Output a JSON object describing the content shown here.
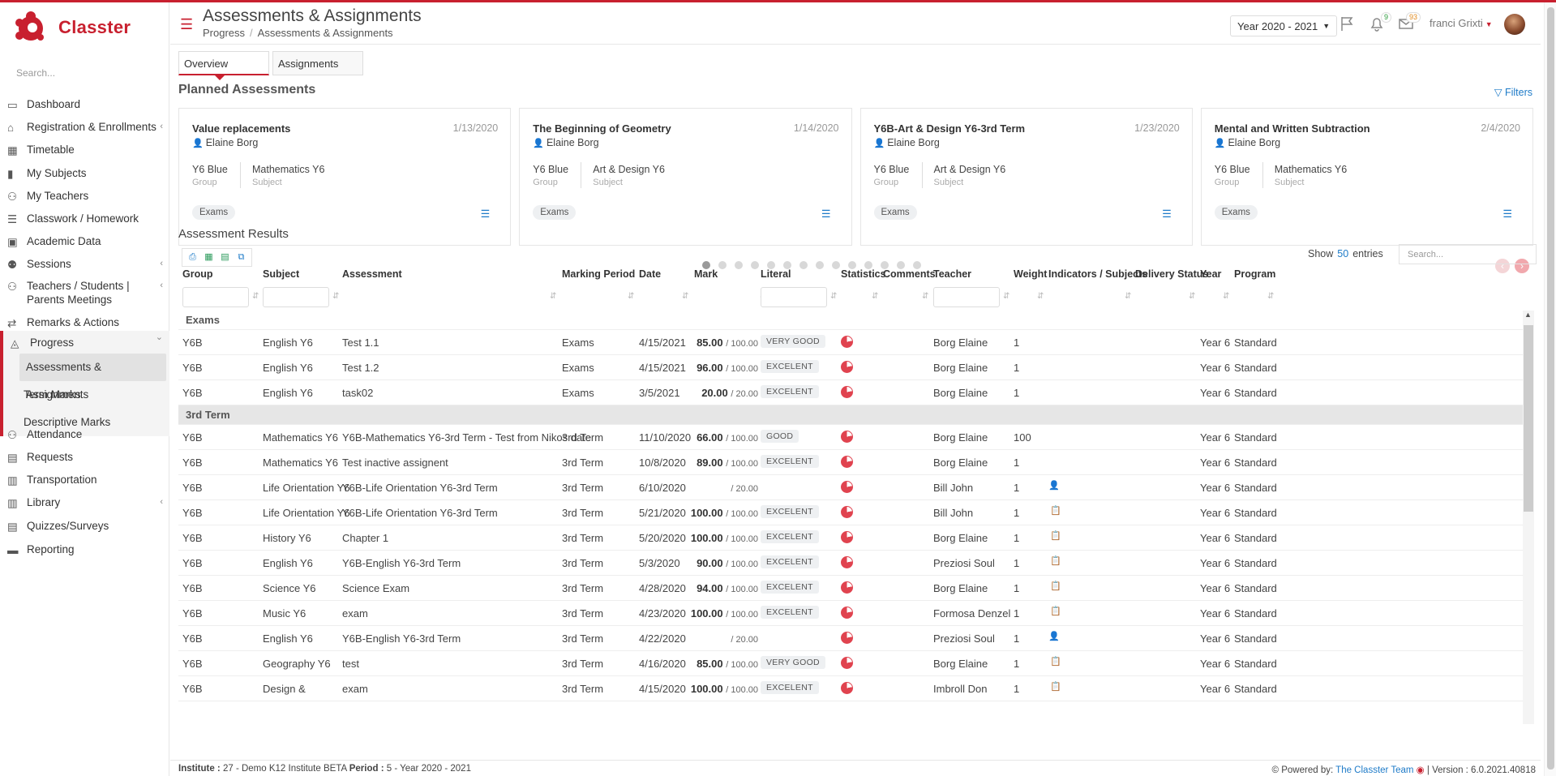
{
  "brand": {
    "name": "Classter",
    "color": "#c8202f"
  },
  "sidebar": {
    "search_placeholder": "Search...",
    "items": [
      {
        "label": "Dashboard",
        "icon": "laptop-icon"
      },
      {
        "label": "Registration & Enrollments",
        "icon": "bank-icon",
        "chev": "‹"
      },
      {
        "label": "Timetable",
        "icon": "calendar-icon"
      },
      {
        "label": "My Subjects",
        "icon": "book-icon"
      },
      {
        "label": "My Teachers",
        "icon": "users-icon"
      },
      {
        "label": "Classwork / Homework",
        "icon": "list-icon"
      },
      {
        "label": "Academic Data",
        "icon": "user-card-icon"
      },
      {
        "label": "Sessions",
        "icon": "group-icon",
        "chev": "‹"
      },
      {
        "label": "Teachers / Students | Parents Meetings",
        "icon": "meeting-icon",
        "chev": "‹"
      },
      {
        "label": "Remarks & Actions",
        "icon": "shuffle-icon"
      },
      {
        "label": "Progress",
        "icon": "graduation-cap-icon",
        "chev": "⌄"
      }
    ],
    "progress_sub": [
      "Assessments & Assignments",
      "Term Marks",
      "Descriptive Marks"
    ],
    "items_after": [
      {
        "label": "Attendance",
        "icon": "user-check-icon"
      },
      {
        "label": "Requests",
        "icon": "document-icon"
      },
      {
        "label": "Transportation",
        "icon": "bus-icon"
      },
      {
        "label": "Library",
        "icon": "library-icon",
        "chev": "‹"
      },
      {
        "label": "Quizzes/Surveys",
        "icon": "quiz-icon"
      },
      {
        "label": "Reporting",
        "icon": "printer-icon"
      }
    ]
  },
  "header": {
    "title": "Assessments & Assignments",
    "breadcrumb": [
      "Progress",
      "Assessments & Assignments"
    ],
    "year": "Year 2020 - 2021",
    "notif_count": "9",
    "msg_count": "93",
    "user": "franci Grixti"
  },
  "tabs": [
    "Overview",
    "Assignments"
  ],
  "planned": {
    "title": "Planned Assessments",
    "filters_label": "Filters",
    "group_label": "Group",
    "subject_label": "Subject",
    "cards": [
      {
        "title": "Value replacements",
        "date": "1/13/2020",
        "teacher": "Elaine Borg",
        "group": "Y6 Blue",
        "subject": "Mathematics Y6",
        "tag": "Exams"
      },
      {
        "title": "The Beginning of Geometry",
        "date": "1/14/2020",
        "teacher": "Elaine Borg",
        "group": "Y6 Blue",
        "subject": "Art & Design Y6",
        "tag": "Exams"
      },
      {
        "title": "Y6B-Art & Design Y6-3rd Term",
        "date": "1/23/2020",
        "teacher": "Elaine Borg",
        "group": "Y6 Blue",
        "subject": "Art & Design Y6",
        "tag": "Exams"
      },
      {
        "title": "Mental and Written Subtraction",
        "date": "2/4/2020",
        "teacher": "Elaine Borg",
        "group": "Y6 Blue",
        "subject": "Mathematics Y6",
        "tag": "Exams"
      }
    ],
    "page_count": 14,
    "active_page": 1
  },
  "results": {
    "title": "Assessment Results",
    "show_label": "Show",
    "entries_count": "50",
    "entries_label": "entries",
    "search_placeholder": "Search...",
    "columns": [
      "Group",
      "Subject",
      "Assessment",
      "Marking Period",
      "Date",
      "Mark",
      "Literal",
      "Statistics",
      "Comments",
      "Teacher",
      "Weight",
      "Indicators / Subjects",
      "Delivery Status",
      "Year",
      "Program"
    ],
    "groups": [
      {
        "name": "Exams",
        "rows": [
          {
            "group": "Y6B",
            "subject": "English Y6",
            "assessment": "Test 1.1",
            "period": "Exams",
            "date": "4/15/2021",
            "mark": "85.00",
            "max": "/ 100.00",
            "literal": "VERY GOOD",
            "teacher": "Borg Elaine",
            "weight": "1",
            "indicator": "",
            "year": "Year 6",
            "program": "Standard"
          },
          {
            "group": "Y6B",
            "subject": "English Y6",
            "assessment": "Test 1.2",
            "period": "Exams",
            "date": "4/15/2021",
            "mark": "96.00",
            "max": "/ 100.00",
            "literal": "EXCELENT",
            "teacher": "Borg Elaine",
            "weight": "1",
            "indicator": "",
            "year": "Year 6",
            "program": "Standard"
          },
          {
            "group": "Y6B",
            "subject": "English Y6",
            "assessment": "task02",
            "period": "Exams",
            "date": "3/5/2021",
            "mark": "20.00",
            "max": "/ 20.00",
            "literal": "EXCELENT",
            "teacher": "Borg Elaine",
            "weight": "1",
            "indicator": "",
            "year": "Year 6",
            "program": "Standard"
          }
        ]
      },
      {
        "name": "3rd Term",
        "rows": [
          {
            "group": "Y6B",
            "subject": "Mathematics Y6",
            "assessment": "Y6B-Mathematics Y6-3rd Term - Test from Nikos date",
            "period": "3rd Term",
            "date": "11/10/2020",
            "mark": "66.00",
            "max": "/ 100.00",
            "literal": "GOOD",
            "teacher": "Borg Elaine",
            "weight": "100",
            "indicator": "",
            "year": "Year 6",
            "program": "Standard"
          },
          {
            "group": "Y6B",
            "subject": "Mathematics Y6",
            "assessment": "Test inactive assignent",
            "period": "3rd Term",
            "date": "10/8/2020",
            "mark": "89.00",
            "max": "/ 100.00",
            "literal": "EXCELENT",
            "teacher": "Borg Elaine",
            "weight": "1",
            "indicator": "",
            "year": "Year 6",
            "program": "Standard"
          },
          {
            "group": "Y6B",
            "subject": "Life Orientation Y6",
            "assessment": "Y6B-Life Orientation Y6-3rd Term",
            "period": "3rd Term",
            "date": "6/10/2020",
            "mark": "",
            "max": "/ 20.00",
            "literal": "",
            "teacher": "Bill John",
            "weight": "1",
            "indicator": "user",
            "year": "Year 6",
            "program": "Standard"
          },
          {
            "group": "Y6B",
            "subject": "Life Orientation Y6",
            "assessment": "Y6B-Life Orientation Y6-3rd Term",
            "period": "3rd Term",
            "date": "5/21/2020",
            "mark": "100.00",
            "max": "/ 100.00",
            "literal": "EXCELENT",
            "teacher": "Bill John",
            "weight": "1",
            "indicator": "clip",
            "year": "Year 6",
            "program": "Standard"
          },
          {
            "group": "Y6B",
            "subject": "History Y6",
            "assessment": "Chapter 1",
            "period": "3rd Term",
            "date": "5/20/2020",
            "mark": "100.00",
            "max": "/ 100.00",
            "literal": "EXCELENT",
            "teacher": "Borg Elaine",
            "weight": "1",
            "indicator": "clip",
            "year": "Year 6",
            "program": "Standard"
          },
          {
            "group": "Y6B",
            "subject": "English Y6",
            "assessment": "Y6B-English Y6-3rd Term",
            "period": "3rd Term",
            "date": "5/3/2020",
            "mark": "90.00",
            "max": "/ 100.00",
            "literal": "EXCELENT",
            "teacher": "Preziosi Soul",
            "weight": "1",
            "indicator": "clip",
            "year": "Year 6",
            "program": "Standard"
          },
          {
            "group": "Y6B",
            "subject": "Science Y6",
            "assessment": "Science Exam",
            "period": "3rd Term",
            "date": "4/28/2020",
            "mark": "94.00",
            "max": "/ 100.00",
            "literal": "EXCELENT",
            "teacher": "Borg Elaine",
            "weight": "1",
            "indicator": "clip",
            "year": "Year 6",
            "program": "Standard"
          },
          {
            "group": "Y6B",
            "subject": "Music Y6",
            "assessment": "exam",
            "period": "3rd Term",
            "date": "4/23/2020",
            "mark": "100.00",
            "max": "/ 100.00",
            "literal": "EXCELENT",
            "teacher": "Formosa Denzel",
            "weight": "1",
            "indicator": "clip",
            "year": "Year 6",
            "program": "Standard"
          },
          {
            "group": "Y6B",
            "subject": "English Y6",
            "assessment": "Y6B-English Y6-3rd Term",
            "period": "3rd Term",
            "date": "4/22/2020",
            "mark": "",
            "max": "/ 20.00",
            "literal": "",
            "teacher": "Preziosi Soul",
            "weight": "1",
            "indicator": "user",
            "year": "Year 6",
            "program": "Standard"
          },
          {
            "group": "Y6B",
            "subject": "Geography Y6",
            "assessment": "test",
            "period": "3rd Term",
            "date": "4/16/2020",
            "mark": "85.00",
            "max": "/ 100.00",
            "literal": "VERY GOOD",
            "teacher": "Borg Elaine",
            "weight": "1",
            "indicator": "clip",
            "year": "Year 6",
            "program": "Standard"
          },
          {
            "group": "Y6B",
            "subject": "Design &",
            "assessment": "exam",
            "period": "3rd Term",
            "date": "4/15/2020",
            "mark": "100.00",
            "max": "/ 100.00",
            "literal": "EXCELENT",
            "teacher": "Imbroll Don",
            "weight": "1",
            "indicator": "clip",
            "year": "Year 6",
            "program": "Standard"
          }
        ]
      }
    ]
  },
  "footer": {
    "institute_label": "Institute :",
    "institute": "27 - Demo K12 Institute BETA",
    "period_label": "Period :",
    "period": "5 - Year 2020 - 2021",
    "powered": "Powered by:",
    "team": "The Classter Team",
    "version": "| Version : 6.0.2021.40818"
  }
}
